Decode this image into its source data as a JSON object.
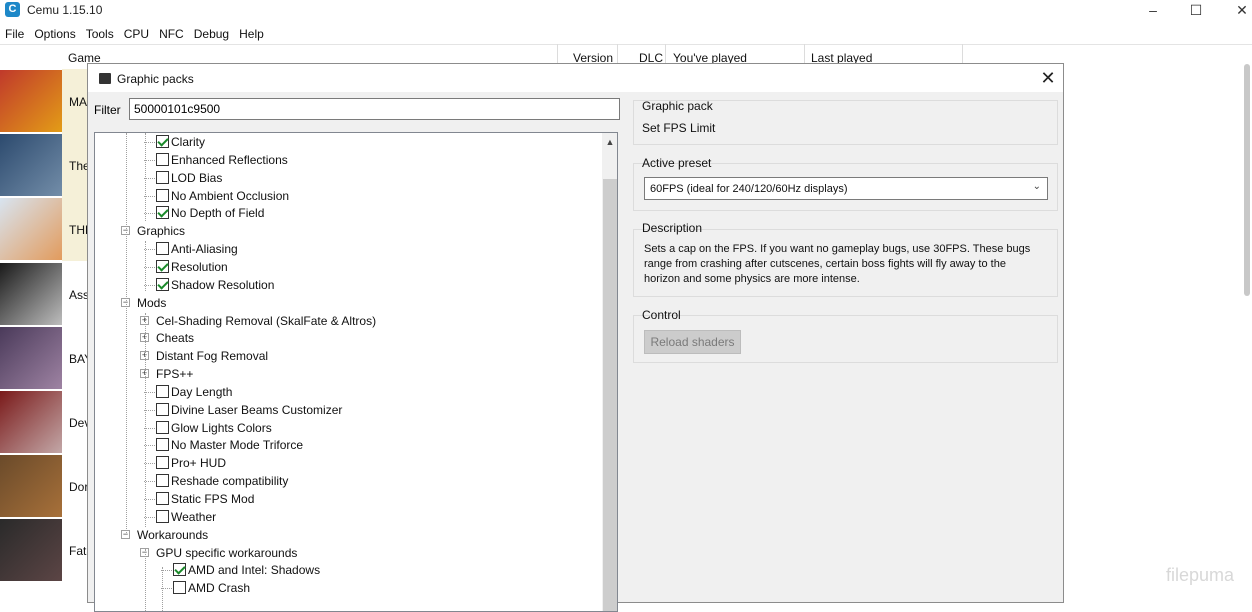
{
  "app": {
    "title": "Cemu 1.15.10",
    "icon_letter": "C"
  },
  "menu": [
    "File",
    "Options",
    "Tools",
    "CPU",
    "NFC",
    "Debug",
    "Help"
  ],
  "game_list": {
    "columns": [
      "Game",
      "Version",
      "DLC",
      "You've played",
      "Last played"
    ],
    "rows": [
      {
        "text": "MA",
        "highlight": "#f5f0d8"
      },
      {
        "text": "The",
        "highlight": "#f5f0d8"
      },
      {
        "text": "THE",
        "highlight": "#f5f0d8"
      },
      {
        "text": "Ass",
        "highlight": "#ffffff"
      },
      {
        "text": "BAY",
        "highlight": "#ffffff"
      },
      {
        "text": "Dev",
        "highlight": "#ffffff"
      },
      {
        "text": "Dor",
        "highlight": "#ffffff"
      },
      {
        "text": "Fata",
        "highlight": "#ffffff"
      }
    ]
  },
  "dialog": {
    "title": "Graphic packs",
    "close": "✕",
    "filter_label": "Filter",
    "filter_value": "50000101c9500",
    "tree": [
      {
        "label": "Clarity",
        "level": 2,
        "kind": "check",
        "checked": true
      },
      {
        "label": "Enhanced Reflections",
        "level": 2,
        "kind": "check",
        "checked": false
      },
      {
        "label": "LOD Bias",
        "level": 2,
        "kind": "check",
        "checked": false
      },
      {
        "label": "No Ambient Occlusion",
        "level": 2,
        "kind": "check",
        "checked": false
      },
      {
        "label": "No Depth of Field",
        "level": 2,
        "kind": "check",
        "checked": true
      },
      {
        "label": "Graphics",
        "level": 1,
        "kind": "folder"
      },
      {
        "label": "Anti-Aliasing",
        "level": 2,
        "kind": "check",
        "checked": false
      },
      {
        "label": "Resolution",
        "level": 2,
        "kind": "check",
        "checked": true
      },
      {
        "label": "Shadow Resolution",
        "level": 2,
        "kind": "check",
        "checked": true
      },
      {
        "label": "Mods",
        "level": 1,
        "kind": "folder"
      },
      {
        "label": "Cel-Shading Removal (SkalFate & Altros)",
        "level": 2,
        "kind": "collapsed"
      },
      {
        "label": "Cheats",
        "level": 2,
        "kind": "collapsed"
      },
      {
        "label": "Distant Fog Removal",
        "level": 2,
        "kind": "collapsed"
      },
      {
        "label": "FPS++",
        "level": 2,
        "kind": "collapsed"
      },
      {
        "label": "Day Length",
        "level": 2,
        "kind": "check",
        "checked": false
      },
      {
        "label": "Divine Laser Beams Customizer",
        "level": 2,
        "kind": "check",
        "checked": false
      },
      {
        "label": "Glow Lights Colors",
        "level": 2,
        "kind": "check",
        "checked": false
      },
      {
        "label": "No Master Mode Triforce",
        "level": 2,
        "kind": "check",
        "checked": false
      },
      {
        "label": "Pro+ HUD",
        "level": 2,
        "kind": "check",
        "checked": false
      },
      {
        "label": "Reshade compatibility",
        "level": 2,
        "kind": "check",
        "checked": false
      },
      {
        "label": "Static FPS Mod",
        "level": 2,
        "kind": "check",
        "checked": false
      },
      {
        "label": "Weather",
        "level": 2,
        "kind": "check",
        "checked": false
      },
      {
        "label": "Workarounds",
        "level": 1,
        "kind": "folder"
      },
      {
        "label": "GPU specific workarounds",
        "level": 2,
        "kind": "folder"
      },
      {
        "label": "AMD and Intel: Shadows",
        "level": 3,
        "kind": "check",
        "checked": true
      },
      {
        "label": "AMD Crash",
        "level": 3,
        "kind": "check",
        "checked": false
      }
    ],
    "graphic_pack": {
      "title": "Graphic pack",
      "value": "Set FPS Limit"
    },
    "active_preset": {
      "title": "Active preset",
      "value": "60FPS (ideal for 240/120/60Hz displays)"
    },
    "description": {
      "title": "Description",
      "text": "Sets a cap on the FPS. If you want no gameplay bugs, use 30FPS. These bugs range from crashing after cutscenes, certain boss fights will fly away to the horizon and some physics are more intense."
    },
    "control": {
      "title": "Control",
      "reload_label": "Reload shaders"
    }
  },
  "watermark": "filepuma"
}
